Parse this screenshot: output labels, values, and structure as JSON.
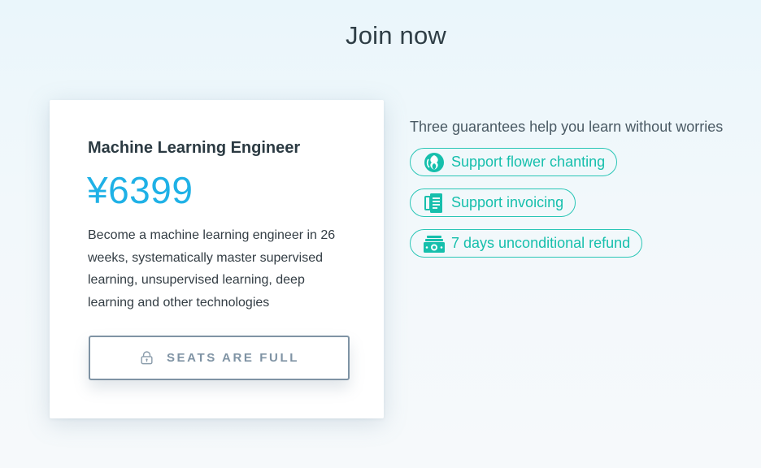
{
  "page": {
    "title": "Join now"
  },
  "card": {
    "title": "Machine Learning Engineer",
    "price": "¥6399",
    "description": "Become a machine learning engineer in 26 weeks, systematically master supervised learning, unsupervised learning, deep learning and other technologies",
    "button_label": "SEATS ARE FULL",
    "button_icon": "lock-icon"
  },
  "guarantees": {
    "heading": "Three guarantees help you learn without worries",
    "items": [
      {
        "label": "Support flower chanting",
        "icon": "flower-chanting-icon"
      },
      {
        "label": "Support invoicing",
        "icon": "invoice-icon"
      },
      {
        "label": "7 days unconditional refund",
        "icon": "refund-cash-icon"
      }
    ]
  },
  "colors": {
    "accent_price": "#1fb1e6",
    "accent_teal": "#16bfac",
    "button_border": "#7f93a4",
    "title_text": "#2b3a42"
  }
}
